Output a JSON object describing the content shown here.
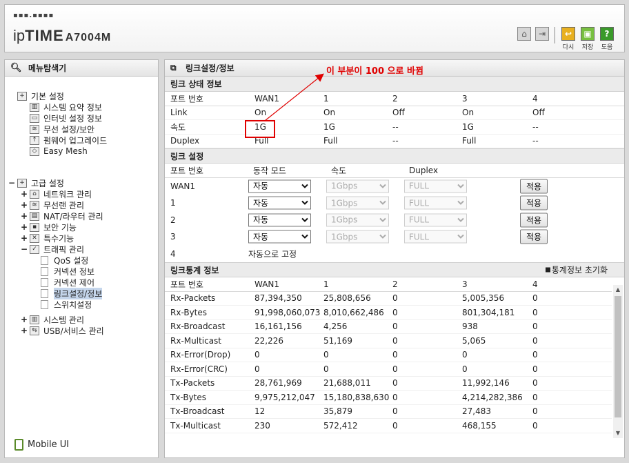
{
  "header": {
    "logo_dots": "▪▪▪.▪▪▪▪",
    "logo_ip": "ip",
    "logo_time": "TIME",
    "model": "A7004M",
    "buttons": [
      {
        "label": "다시",
        "icon": "redo-icon",
        "color": "#e0a000"
      },
      {
        "label": "저장",
        "icon": "save-icon",
        "color": "#5ab030"
      },
      {
        "label": "도움",
        "icon": "help-icon",
        "color": "#3a9a2a"
      }
    ]
  },
  "sidebar": {
    "title": "메뉴탐색기",
    "basic": {
      "label": "기본 설정",
      "items": [
        "시스템 요약 정보",
        "인터넷 설정 정보",
        "무선 설정/보안",
        "펌웨어 업그레이드",
        "Easy Mesh"
      ]
    },
    "advanced": {
      "label": "고급 설정",
      "items": [
        "네트워크 관리",
        "무선랜 관리",
        "NAT/라우터 관리",
        "보안 기능",
        "특수기능",
        "트래픽 관리"
      ],
      "traffic_children": [
        "QoS 설정",
        "커넥션 정보",
        "커넥션 제어",
        "링크설정/정보",
        "스위치설정"
      ],
      "more": [
        "시스템 관리",
        "USB/서비스 관리"
      ]
    },
    "mobile": "Mobile UI"
  },
  "main": {
    "title": "링크설정/정보",
    "annotation": "이 부분이 100 으로 바뀜",
    "status": {
      "title": "링크 상태 정보",
      "headers": [
        "포트 번호",
        "WAN1",
        "1",
        "2",
        "3",
        "4"
      ],
      "rows": [
        [
          "Link",
          "On",
          "On",
          "Off",
          "On",
          "Off"
        ],
        [
          "속도",
          "1G",
          "1G",
          "--",
          "1G",
          "--"
        ],
        [
          "Duplex",
          "Full",
          "Full",
          "--",
          "Full",
          "--"
        ]
      ]
    },
    "settings": {
      "title": "링크 설정",
      "headers": [
        "포트 번호",
        "동작 모드",
        "속도",
        "Duplex"
      ],
      "rows": [
        {
          "port": "WAN1",
          "mode": "자동",
          "speed": "1Gbps",
          "duplex": "FULL",
          "apply": "적용"
        },
        {
          "port": "1",
          "mode": "자동",
          "speed": "1Gbps",
          "duplex": "FULL",
          "apply": "적용"
        },
        {
          "port": "2",
          "mode": "자동",
          "speed": "1Gbps",
          "duplex": "FULL",
          "apply": "적용"
        },
        {
          "port": "3",
          "mode": "자동",
          "speed": "1Gbps",
          "duplex": "FULL",
          "apply": "적용"
        }
      ],
      "fixed_row": {
        "port": "4",
        "text": "자동으로 고정"
      }
    },
    "stats": {
      "title": "링크통계 정보",
      "reset": "통계정보 초기화",
      "headers": [
        "포트 번호",
        "WAN1",
        "1",
        "2",
        "3",
        "4"
      ],
      "rows": [
        [
          "Rx-Packets",
          "87,394,350",
          "25,808,656",
          "0",
          "5,005,356",
          "0"
        ],
        [
          "Rx-Bytes",
          "91,998,060,073",
          "8,010,662,486",
          "0",
          "801,304,181",
          "0"
        ],
        [
          "Rx-Broadcast",
          "16,161,156",
          "4,256",
          "0",
          "938",
          "0"
        ],
        [
          "Rx-Multicast",
          "22,226",
          "51,169",
          "0",
          "5,065",
          "0"
        ],
        [
          "Rx-Error(Drop)",
          "0",
          "0",
          "0",
          "0",
          "0"
        ],
        [
          "Rx-Error(CRC)",
          "0",
          "0",
          "0",
          "0",
          "0"
        ],
        [
          "Tx-Packets",
          "28,761,969",
          "21,688,011",
          "0",
          "11,992,146",
          "0"
        ],
        [
          "Tx-Bytes",
          "9,975,212,047",
          "15,180,838,630",
          "0",
          "4,214,282,386",
          "0"
        ],
        [
          "Tx-Broadcast",
          "12",
          "35,879",
          "0",
          "27,483",
          "0"
        ],
        [
          "Tx-Multicast",
          "230",
          "572,412",
          "0",
          "468,155",
          "0"
        ]
      ]
    }
  }
}
